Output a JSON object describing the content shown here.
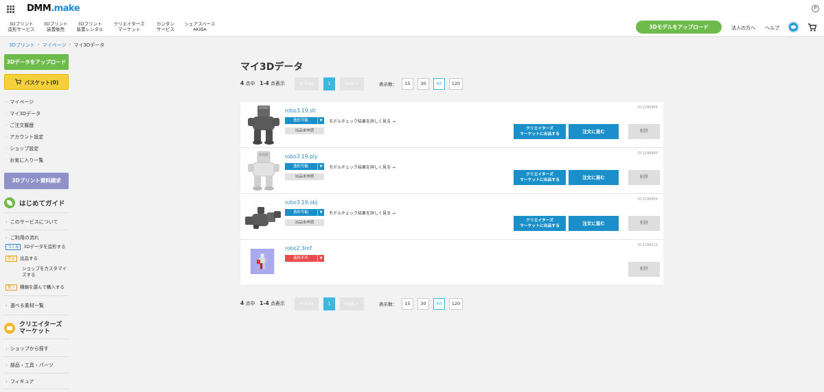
{
  "header": {
    "logo_main": "DMM",
    "logo_sub": ".make",
    "points_icon": "P",
    "nav": [
      {
        "line1": "3Dプリント",
        "line2": "造形サービス"
      },
      {
        "line1": "3Dプリント",
        "line2": "装置販売"
      },
      {
        "line1": "3Dプリント",
        "line2": "装置レンタル"
      },
      {
        "line1": "クリエイターズ",
        "line2": "マーケット"
      },
      {
        "line1": "カンタン",
        "line2": "サービス"
      },
      {
        "line1": "シェアスペース",
        "line2": "AKIBA"
      }
    ],
    "upload_label": "3Dモデルをアップロード",
    "corporate_label": "法人の方へ",
    "help_label": "ヘルプ"
  },
  "breadcrumb": [
    "3Dプリント",
    "マイページ",
    "マイ3Dデータ"
  ],
  "sidebar": {
    "upload_label": "3Dデータをアップロード",
    "basket_label": "バスケット(0)",
    "menu": [
      "マイページ",
      "マイ3Dデータ",
      "ご注文履歴",
      "アカウント設定",
      "ショップ設定",
      "お気に入り一覧"
    ],
    "catalog_label": "3Dプリント資料請求",
    "guide_title": "はじめてガイド",
    "about_label": "このサービスについて",
    "flow_label": "ご利用の流れ",
    "steps": [
      {
        "tag": "つくる",
        "text": "3Dデータを造形する"
      },
      {
        "tag": "売る",
        "text": "出品する"
      },
      {
        "tag": "",
        "text": "ショップをカスタマイズする"
      },
      {
        "tag": "買う",
        "text": "種類を選んで購入する"
      }
    ],
    "materials_label": "選べる素材一覧",
    "market_title_1": "クリエイターズ",
    "market_title_2": "マーケット",
    "shop_search_label": "ショップから探す",
    "parts_label": "部品・工具・パーツ",
    "figure_label": "フィギュア"
  },
  "main": {
    "title": "マイ3Dデータ",
    "pager": {
      "total": "4",
      "total_suffix": "点中",
      "range": "1-4",
      "range_suffix": "点表示",
      "prev": "< Prev",
      "current": "1",
      "next": "Next >",
      "per_page_label": "表示数：",
      "per_page_options": [
        "15",
        "30",
        "60",
        "120"
      ],
      "per_page_selected": "60"
    },
    "items": [
      {
        "name": "robo3.19.stl",
        "status": "造形可能",
        "status_type": "ok",
        "check_link": "モデルチェック結果を詳しく見る →",
        "listing": "出品未申請",
        "id": "ID:1296866",
        "creator_l1": "クリエイターズ",
        "creator_l2": "マーケットに出品する",
        "order": "注文に進む",
        "delete": "削除",
        "thumb": "robot-gray"
      },
      {
        "name": "robo3.19.ply",
        "status": "造形可能",
        "status_type": "ok",
        "check_link": "モデルチェック結果を詳しく見る →",
        "listing": "出品未申請",
        "id": "ID:1296865",
        "creator_l1": "クリエイターズ",
        "creator_l2": "マーケットに出品する",
        "order": "注文に進む",
        "delete": "削除",
        "thumb": "robot-white"
      },
      {
        "name": "robo3.19.obj",
        "status": "造形可能",
        "status_type": "ok",
        "check_link": "モデルチェック結果を詳しく見る →",
        "listing": "出品未申請",
        "id": "ID:1296864",
        "creator_l1": "クリエイターズ",
        "creator_l2": "マーケットに出品する",
        "order": "注文に進む",
        "delete": "削除",
        "thumb": "robot-lying"
      },
      {
        "name": "robo2.3mf",
        "status": "造形不可",
        "status_type": "ng",
        "check_link": "",
        "listing": "",
        "id": "ID:1296510",
        "creator_l1": "",
        "creator_l2": "",
        "order": "",
        "delete": "削除",
        "thumb": "robot-color"
      }
    ]
  },
  "colors": {
    "green": "#6dbb4b",
    "blue": "#1a8fc9",
    "light_blue": "#3db7de",
    "red": "#e84b4b",
    "yellow": "#f5d03a",
    "purple": "#8f92c9"
  }
}
